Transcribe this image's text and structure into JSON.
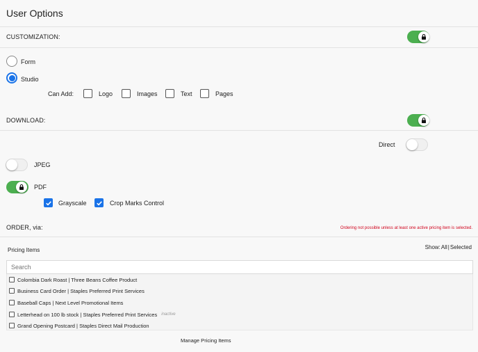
{
  "page": {
    "title": "User Options"
  },
  "customization": {
    "label": "CUSTOMIZATION:",
    "enabled": true,
    "options": [
      {
        "label": "Form",
        "selected": false
      },
      {
        "label": "Studio",
        "selected": true
      }
    ],
    "can_add_label": "Can Add:",
    "can_add": [
      {
        "label": "Logo",
        "checked": false
      },
      {
        "label": "Images",
        "checked": false
      },
      {
        "label": "Text",
        "checked": false
      },
      {
        "label": "Pages",
        "checked": false
      }
    ]
  },
  "download": {
    "label": "DOWNLOAD:",
    "enabled": true,
    "direct": {
      "label": "Direct",
      "enabled": false
    },
    "jpeg": {
      "label": "JPEG",
      "enabled": false
    },
    "pdf": {
      "label": "PDF",
      "enabled": true
    },
    "pdf_options": [
      {
        "label": "Grayscale",
        "checked": true
      },
      {
        "label": "Crop Marks Control",
        "checked": true
      }
    ]
  },
  "order": {
    "label": "ORDER, via:",
    "warning": "Ordering not possible unless at least one active pricing item is selected."
  },
  "pricing": {
    "label": "Pricing Items",
    "show_label": "Show:",
    "show_all": "All",
    "show_sep": "|",
    "show_selected": "Selected",
    "search_placeholder": "Search",
    "items": [
      {
        "name": "Colombia Dark Roast | Three Beans Coffee Product",
        "status": ""
      },
      {
        "name": "Business Card Order | Staples Preferred Print Services",
        "status": ""
      },
      {
        "name": "Baseball Caps | Next Level Promotional Items",
        "status": ""
      },
      {
        "name": "Letterhead on 100 lb stock | Staples Preferred Print Services",
        "status": "inactive"
      },
      {
        "name": "Grand Opening Postcard | Staples Direct Mail Production",
        "status": ""
      }
    ],
    "manage_label": "Manage Pricing Items"
  },
  "colors": {
    "toggle_on": "#4caf50",
    "accent": "#1a73e8",
    "warning": "#d0021b"
  }
}
